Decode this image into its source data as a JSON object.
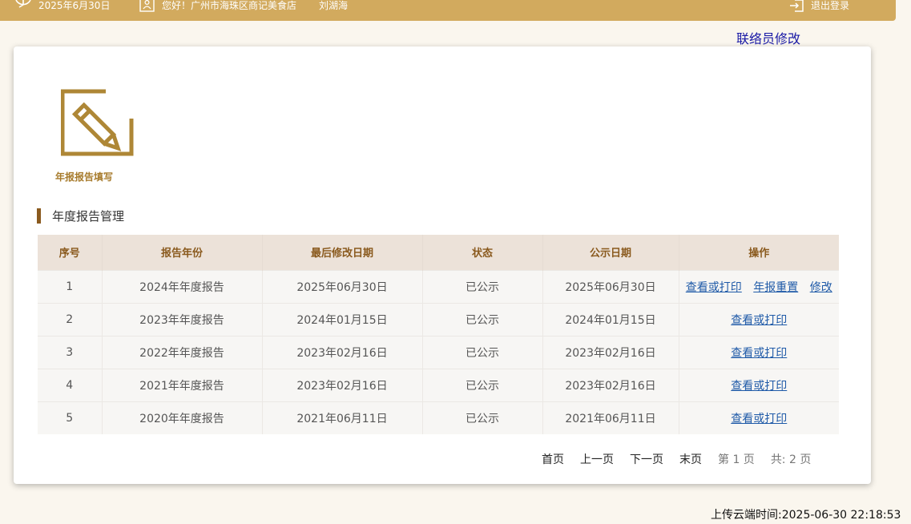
{
  "topbar": {
    "date": "2025年6月30日",
    "greeting": "您好！广州市海珠区商记美食店",
    "user": "刘湖海",
    "logout": "退出登录"
  },
  "contact_link": "联络员修改",
  "feature": {
    "label": "年报报告填写",
    "icon": "edit-pencil-icon"
  },
  "section_title": "年度报告管理",
  "table": {
    "headers": [
      "序号",
      "报告年份",
      "最后修改日期",
      "状态",
      "公示日期",
      "操作"
    ],
    "rows": [
      {
        "no": "1",
        "year": "2024年年度报告",
        "modified": "2025年06月30日",
        "status": "已公示",
        "public": "2025年06月30日",
        "ops": [
          "查看或打印",
          "年报重置",
          "修改"
        ]
      },
      {
        "no": "2",
        "year": "2023年年度报告",
        "modified": "2024年01月15日",
        "status": "已公示",
        "public": "2024年01月15日",
        "ops": [
          "查看或打印"
        ]
      },
      {
        "no": "3",
        "year": "2022年年度报告",
        "modified": "2023年02月16日",
        "status": "已公示",
        "public": "2023年02月16日",
        "ops": [
          "查看或打印"
        ]
      },
      {
        "no": "4",
        "year": "2021年年度报告",
        "modified": "2023年02月16日",
        "status": "已公示",
        "public": "2023年02月16日",
        "ops": [
          "查看或打印"
        ]
      },
      {
        "no": "5",
        "year": "2020年年度报告",
        "modified": "2021年06月11日",
        "status": "已公示",
        "public": "2021年06月11日",
        "ops": [
          "查看或打印"
        ]
      }
    ]
  },
  "pager": {
    "first": "首页",
    "prev": "上一页",
    "next": "下一页",
    "last": "末页",
    "current": "第 1 页",
    "total": "共:  2 页"
  },
  "upload_time": "上传云端时间:2025-06-30 22:18:53",
  "colors": {
    "topbar": "#d2aa5e",
    "accent": "#8a5a1e",
    "link": "#1f5aa8"
  }
}
